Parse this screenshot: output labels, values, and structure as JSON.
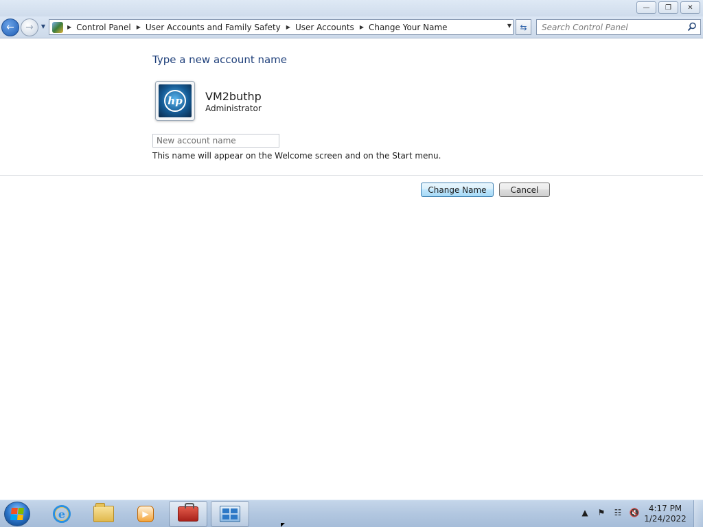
{
  "window": {
    "caption_buttons": {
      "minimize": "—",
      "restore": "❐",
      "close": "✕"
    }
  },
  "navigation": {
    "back_icon": "back-arrow-icon",
    "forward_icon": "forward-arrow-icon",
    "breadcrumbs": [
      "Control Panel",
      "User Accounts and Family Safety",
      "User Accounts",
      "Change Your Name"
    ],
    "search_placeholder": "Search Control Panel"
  },
  "content": {
    "heading": "Type a new account name",
    "user": {
      "name": "VM2buthp",
      "role": "Administrator",
      "avatar_logo": "hp"
    },
    "new_name_placeholder": "New account name",
    "new_name_value": "",
    "hint": "This name will appear on the Welcome screen and on the Start menu.",
    "primary_button": "Change Name",
    "secondary_button": "Cancel"
  },
  "taskbar": {
    "ie_glyph": "e",
    "time": "4:17 PM",
    "date": "1/24/2022"
  },
  "colors": {
    "heading": "#1e3f7a",
    "primary_border": "#3c7fb1",
    "taskbar": "#b2c7e0"
  }
}
